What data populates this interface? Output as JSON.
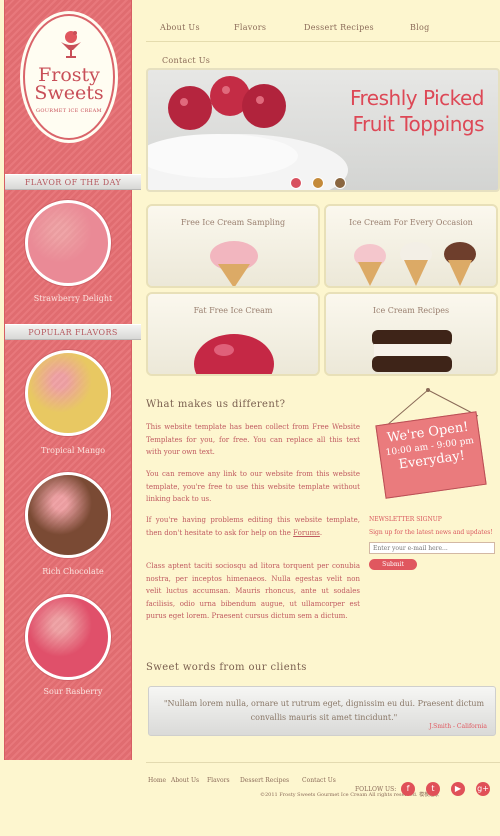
{
  "brand": {
    "line1": "Frosty",
    "line2": "Sweets",
    "tagline": "GOURMET ICE CREAM"
  },
  "nav": [
    {
      "label": "About Us"
    },
    {
      "label": "Flavors"
    },
    {
      "label": "Dessert Recipes"
    },
    {
      "label": "Blog"
    },
    {
      "label": "Contact Us"
    }
  ],
  "sidebar": {
    "flavor_of_day_heading": "FLAVOR OF THE DAY",
    "flavor_of_day": {
      "label": "Strawberry Delight",
      "color": "#ea8a96"
    },
    "popular_heading": "POPULAR FLAVORS",
    "popular": [
      {
        "label": "Tropical Mango",
        "color": "#e8c862"
      },
      {
        "label": "Rich Chocolate",
        "color": "#7a4a34"
      },
      {
        "label": "Sour Rasberry",
        "color": "#e0506a"
      }
    ]
  },
  "banner": {
    "line1": "Freshly Picked",
    "line2": "Fruit Toppings",
    "accent": "#dd4856"
  },
  "tiles": [
    {
      "title": "Free Ice Cream Sampling"
    },
    {
      "title": "Ice Cream For Every Occasion"
    },
    {
      "title": "Fat Free Ice Cream"
    },
    {
      "title": "Ice Cream Recipes"
    }
  ],
  "content": {
    "heading": "What makes us different?",
    "p1": "This website template has been collect from Free Website Templates for you, for free. You can replace all this text with your own text.",
    "p2": "You can remove any link to our website from this website template, you're free to use this website template without linking back to us.",
    "p3_before": "If you're having problems editing this website template, then don't hesitate to ask for help on the",
    "p3_link": "Forums",
    "p3_after": ".",
    "p4": "Class aptent taciti sociosqu ad litora torquent per conubia nostra, per inceptos himenaeos. Nulla egestas velit non velit luctus accumsan. Mauris rhoncus, ante ut sodales facilisis, odio urna bibendum augue, ut ullamcorper est purus eget lorem. Praesent cursus dictum sem a dictum."
  },
  "sign": {
    "line1": "We're Open!",
    "line2": "10:00 am - 9:00 pm",
    "line3": "Everyday!"
  },
  "newsletter": {
    "title": "NEWSLETTER SIGNUP",
    "subtitle": "Sign up for the latest news and updates!",
    "placeholder": "Enter your e-mail here...",
    "button": "Submit"
  },
  "testimonials": {
    "heading": "Sweet words from our clients",
    "quote": "\"Nullam lorem nulla, ornare ut rutrum eget, dignissim eu dui. Praesent dictum convallis mauris sit amet tincidunt.\"",
    "author": "J.Smith - California"
  },
  "footer": {
    "nav": [
      "Home",
      "About Us",
      "Flavors",
      "Dessert Recipes",
      "Contact Us"
    ],
    "copyright": "©2011 Frosty Sweets Gourmet Ice Cream All rights reserved. 模板之家",
    "follow_label": "FOLLOW US:",
    "social": [
      {
        "icon": "facebook-icon",
        "glyph": "f"
      },
      {
        "icon": "twitter-icon",
        "glyph": "t"
      },
      {
        "icon": "youtube-icon",
        "glyph": "▶"
      },
      {
        "icon": "google-plus-icon",
        "glyph": "g+"
      }
    ]
  }
}
